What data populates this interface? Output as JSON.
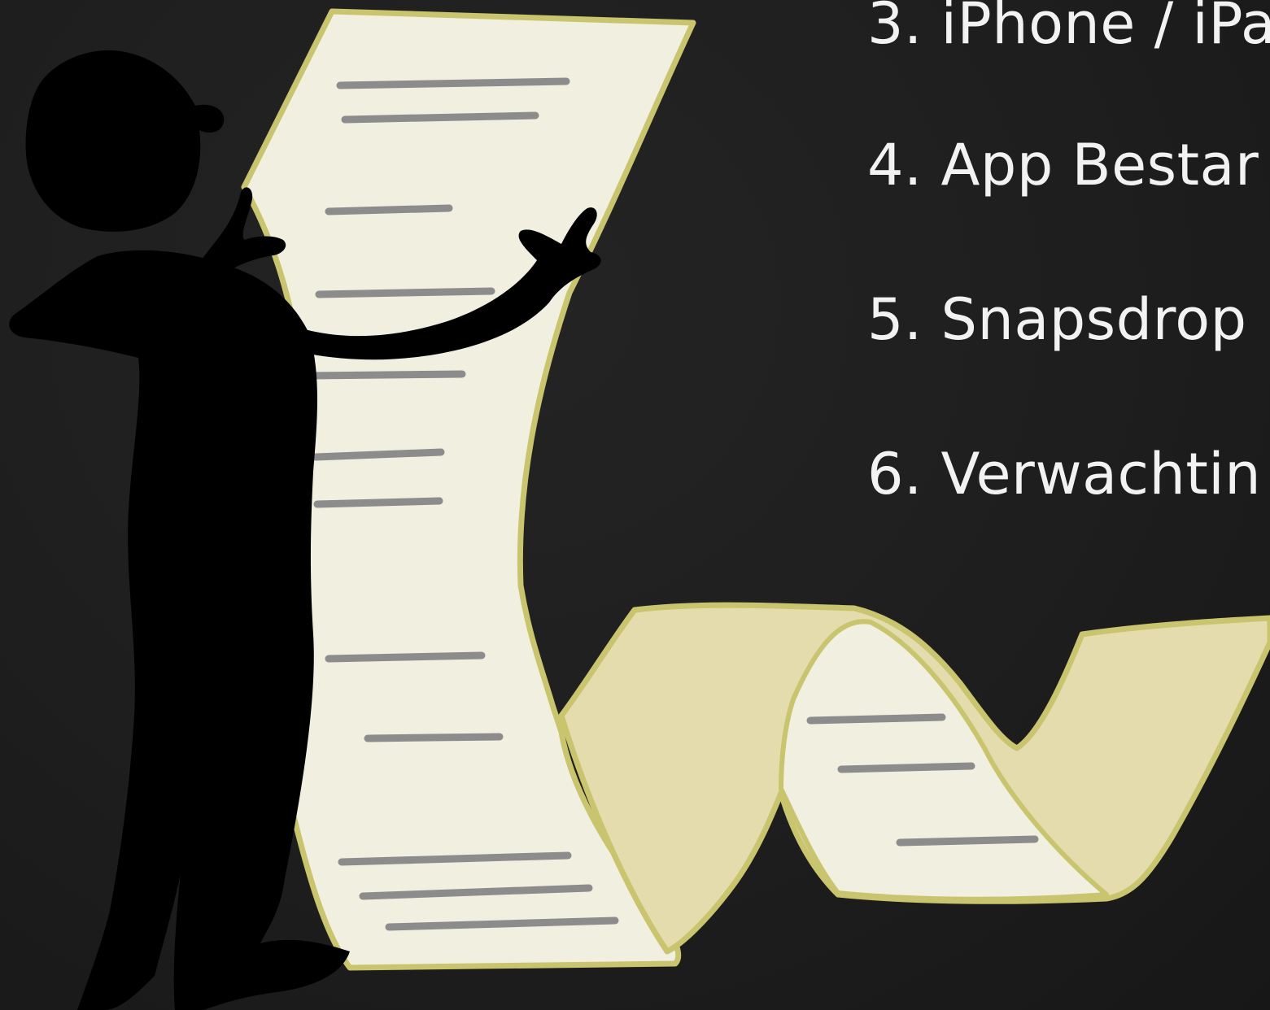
{
  "slide": {
    "agenda_items": [
      "3. iPhone / iPa",
      "4. App Bestar",
      "5. Snapsdrop",
      "6. Verwachtin"
    ]
  },
  "illustration": {
    "name": "person-reading-long-list-illustration",
    "colors": {
      "silhouette": "#000000",
      "paper": "#f1efdf",
      "paper_shadow": "#e2dba8",
      "paper_border": "#c9c46e",
      "text_lines": "#8c8c8c",
      "background": "#1e1e1e"
    }
  }
}
